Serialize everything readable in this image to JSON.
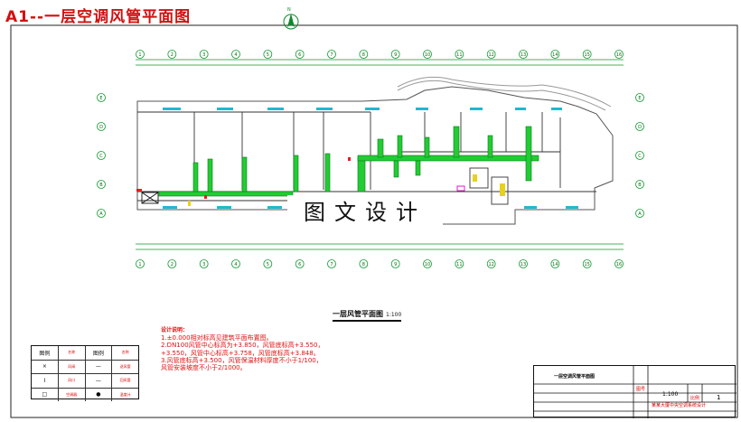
{
  "sheet": {
    "title": "A1--一层空调风管平面图",
    "watermark": "图文设计"
  },
  "plan": {
    "caption": "一层风管平面图",
    "scale": "1:100",
    "north": "N"
  },
  "axes": {
    "top": [
      "1",
      "2",
      "3",
      "4",
      "5",
      "6",
      "7",
      "8",
      "9",
      "10",
      "11",
      "12",
      "13",
      "14",
      "15",
      "16"
    ],
    "side": [
      "A",
      "B",
      "C",
      "D",
      "E"
    ]
  },
  "notes": {
    "heading": "设计说明：",
    "lines": [
      "1.±0.000相对标高见建筑平面布置图。",
      "2.DN100风管中心标高为+3.850，风管底标高+3.550，",
      "+3.550，风管中心标高+3.758，风管底标高+3.848。",
      "3.风管底标高+3.500，风管保温材料厚度不小于1/100，",
      "风管安装坡度不小于2/1000。"
    ]
  },
  "legend": {
    "rows": [
      [
        "图例",
        "名称",
        "图例",
        "名称"
      ],
      [
        "×",
        "风阀",
        "—",
        "送风管"
      ],
      [
        "I",
        "风口",
        "—",
        "回风管"
      ],
      [
        "□",
        "空调器",
        "●",
        "温度计"
      ]
    ]
  },
  "title_block": {
    "drawing_name": "一层空调风管平面图",
    "scale": "1:100",
    "page": "1",
    "project": "某某大厦中央空调系统设计",
    "label_drawing": "图号",
    "label_scale": "比例"
  }
}
